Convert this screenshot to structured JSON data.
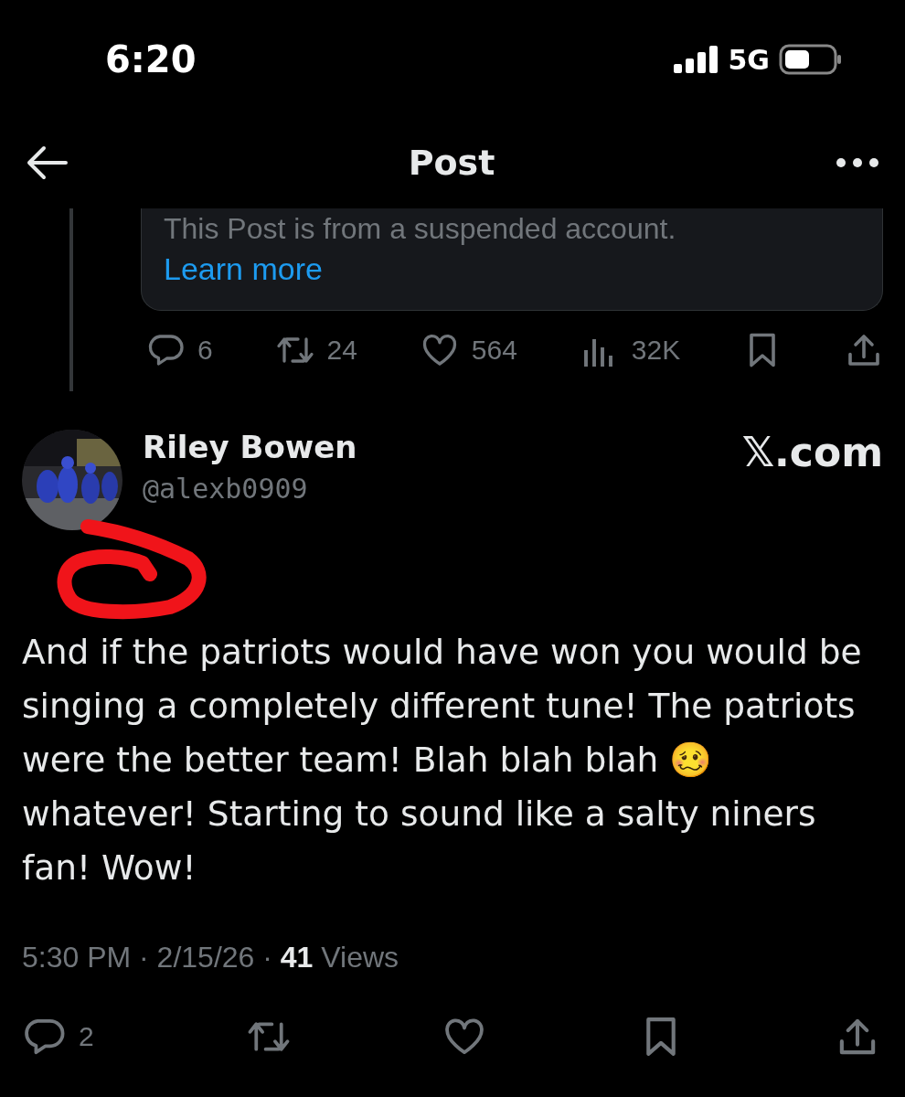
{
  "status_bar": {
    "time": "6:20",
    "network": "5G"
  },
  "header": {
    "title": "Post"
  },
  "quoted_post": {
    "notice": "This Post is from a suspended account.",
    "link": "Learn more",
    "actions": [
      {
        "kind": "reply",
        "count": "6"
      },
      {
        "kind": "repost",
        "count": "24"
      },
      {
        "kind": "like",
        "count": "564"
      },
      {
        "kind": "views",
        "count": "32K"
      },
      {
        "kind": "bookmark"
      },
      {
        "kind": "share"
      }
    ]
  },
  "post": {
    "author": {
      "name": "Riley Bowen",
      "handle": "@alexb0909"
    },
    "watermark": "𝕏.com",
    "text": "And if the patriots would have won you would be singing a completely different tune! The patriots were the better team! Blah blah blah 🥴 whatever! Starting to sound like a salty niners fan! Wow!",
    "time": "5:30 PM · 2/15/26 · ",
    "views_count": "41",
    "views_label": " Views",
    "actions": [
      {
        "kind": "reply",
        "count": "2"
      },
      {
        "kind": "repost"
      },
      {
        "kind": "like"
      },
      {
        "kind": "bookmark"
      },
      {
        "kind": "share"
      }
    ]
  }
}
